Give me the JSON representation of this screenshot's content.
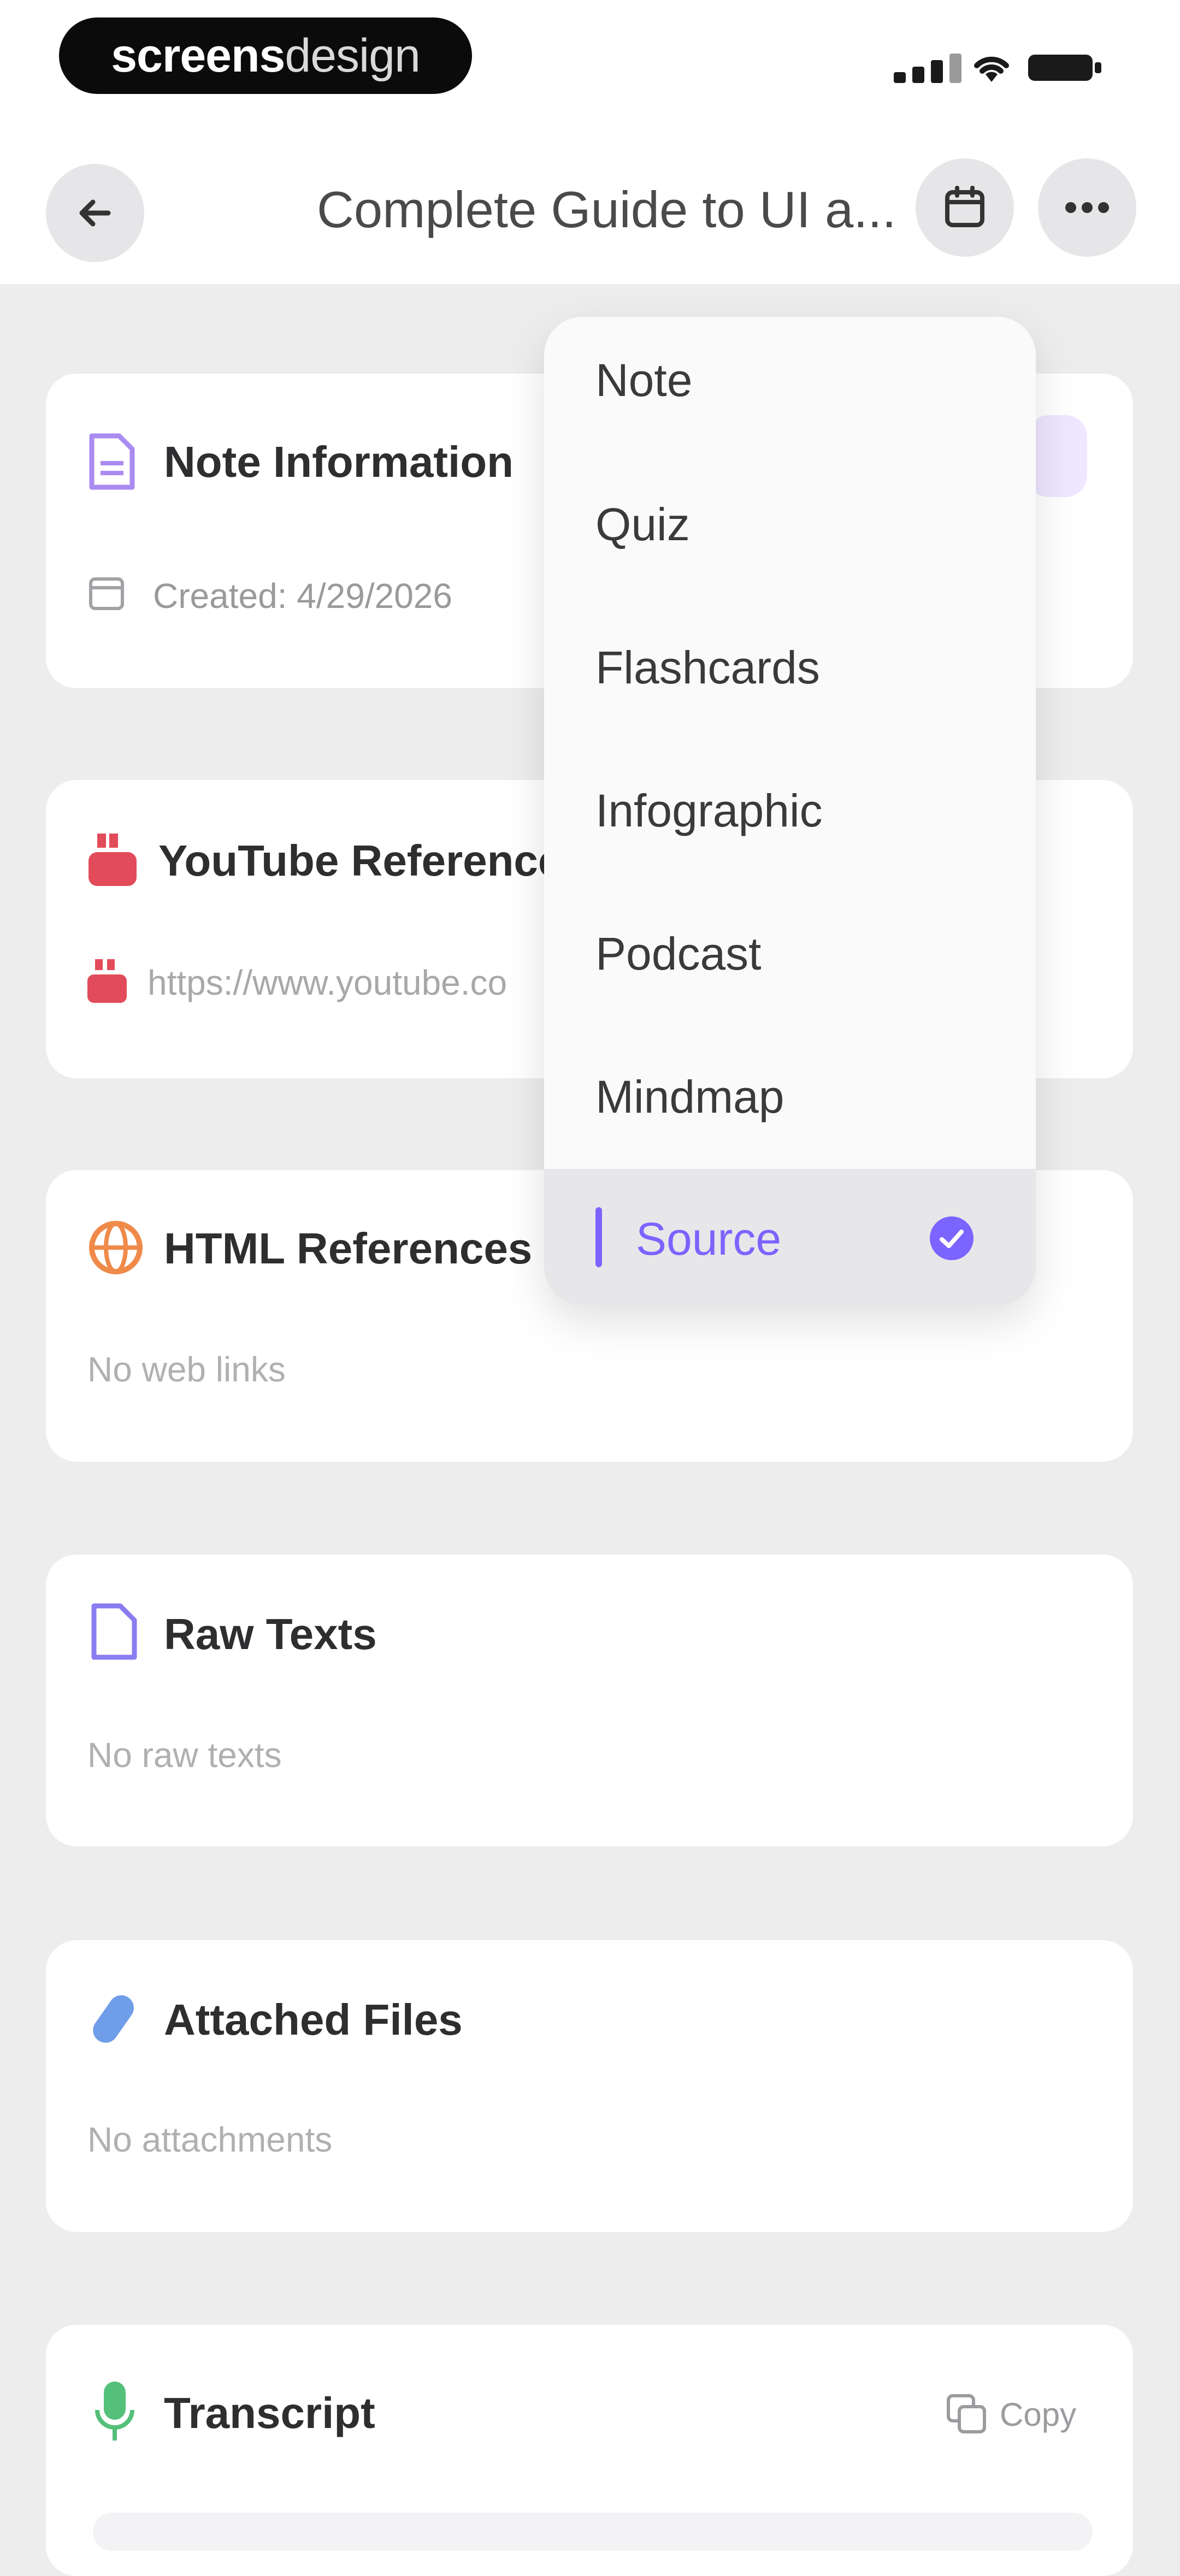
{
  "status": {
    "brand_part1": "screens",
    "brand_part2": "design"
  },
  "app_bar": {
    "title": "Complete Guide to UI a..."
  },
  "cards": {
    "note_info": {
      "title": "Note Information",
      "created": "Created: 4/29/2026"
    },
    "youtube": {
      "title": "YouTube References",
      "link": "https://www.youtube.co"
    },
    "html": {
      "title": "HTML References",
      "empty": "No web links"
    },
    "raw": {
      "title": "Raw Texts",
      "empty": "No raw texts"
    },
    "files": {
      "title": "Attached Files",
      "empty": "No attachments"
    },
    "transcript": {
      "title": "Transcript",
      "copy": "Copy"
    }
  },
  "menu": {
    "items": [
      "Note",
      "Quiz",
      "Flashcards",
      "Infographic",
      "Podcast",
      "Mindmap",
      "Source"
    ],
    "selected_index": 6
  },
  "colors": {
    "accent": "#7b64ff",
    "youtube_red": "#e24b59",
    "orange": "#f08a4b",
    "blue": "#6f9de8",
    "green": "#55c07a",
    "purple": "#a98bf2"
  }
}
